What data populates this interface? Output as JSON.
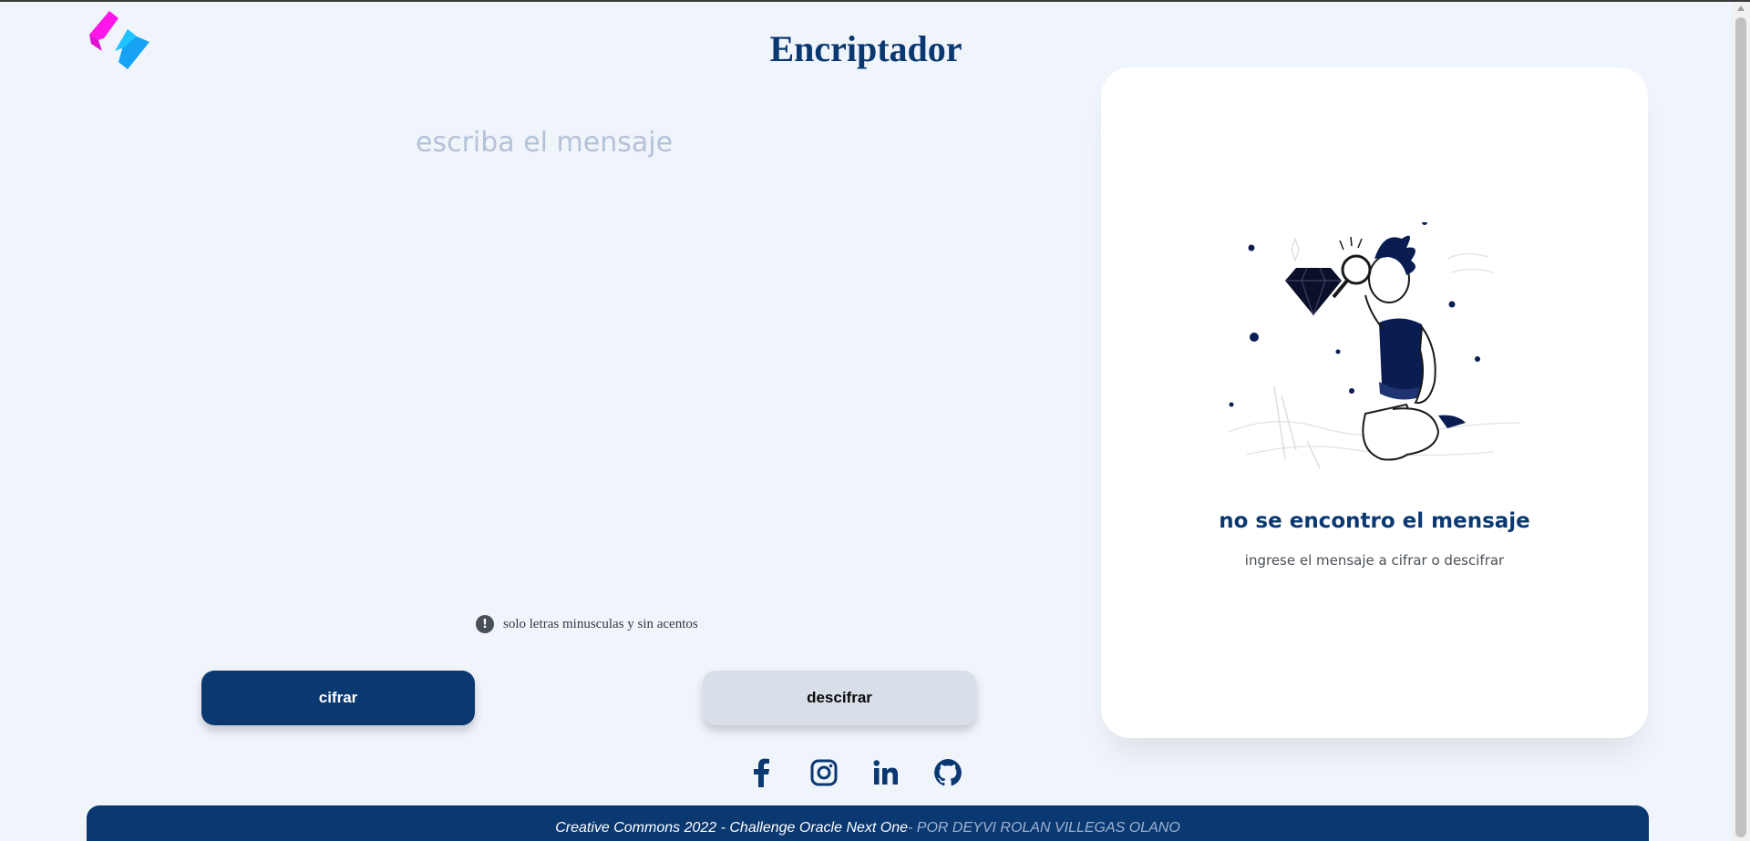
{
  "app": {
    "title": "Encriptador"
  },
  "editor": {
    "placeholder": "escriba el mensaje",
    "value": ""
  },
  "hint": {
    "icon": "exclamation-icon",
    "text": "solo letras minusculas y sin acentos"
  },
  "actions": {
    "encrypt_label": "cifrar",
    "decrypt_label": "descifrar"
  },
  "result_panel": {
    "title": "no se encontro el mensaje",
    "subtitle": "ingrese el mensaje a cifrar o descifrar",
    "illustration": "person-inspecting-diamond-illustration"
  },
  "socials": [
    {
      "icon": "facebook-icon"
    },
    {
      "icon": "instagram-icon"
    },
    {
      "icon": "linkedin-icon"
    },
    {
      "icon": "github-icon"
    }
  ],
  "footer": {
    "main": "Creative Commons 2022 - Challenge Oracle Next One",
    "author": "- POR DEYVI ROLAN VILLEGAS OLANO"
  },
  "colors": {
    "primary": "#0a3871",
    "background": "#f0f4fb",
    "secondary_button": "#d8dfe8",
    "logo_pink": "#ff16e8",
    "logo_blue": "#16a3f5"
  }
}
